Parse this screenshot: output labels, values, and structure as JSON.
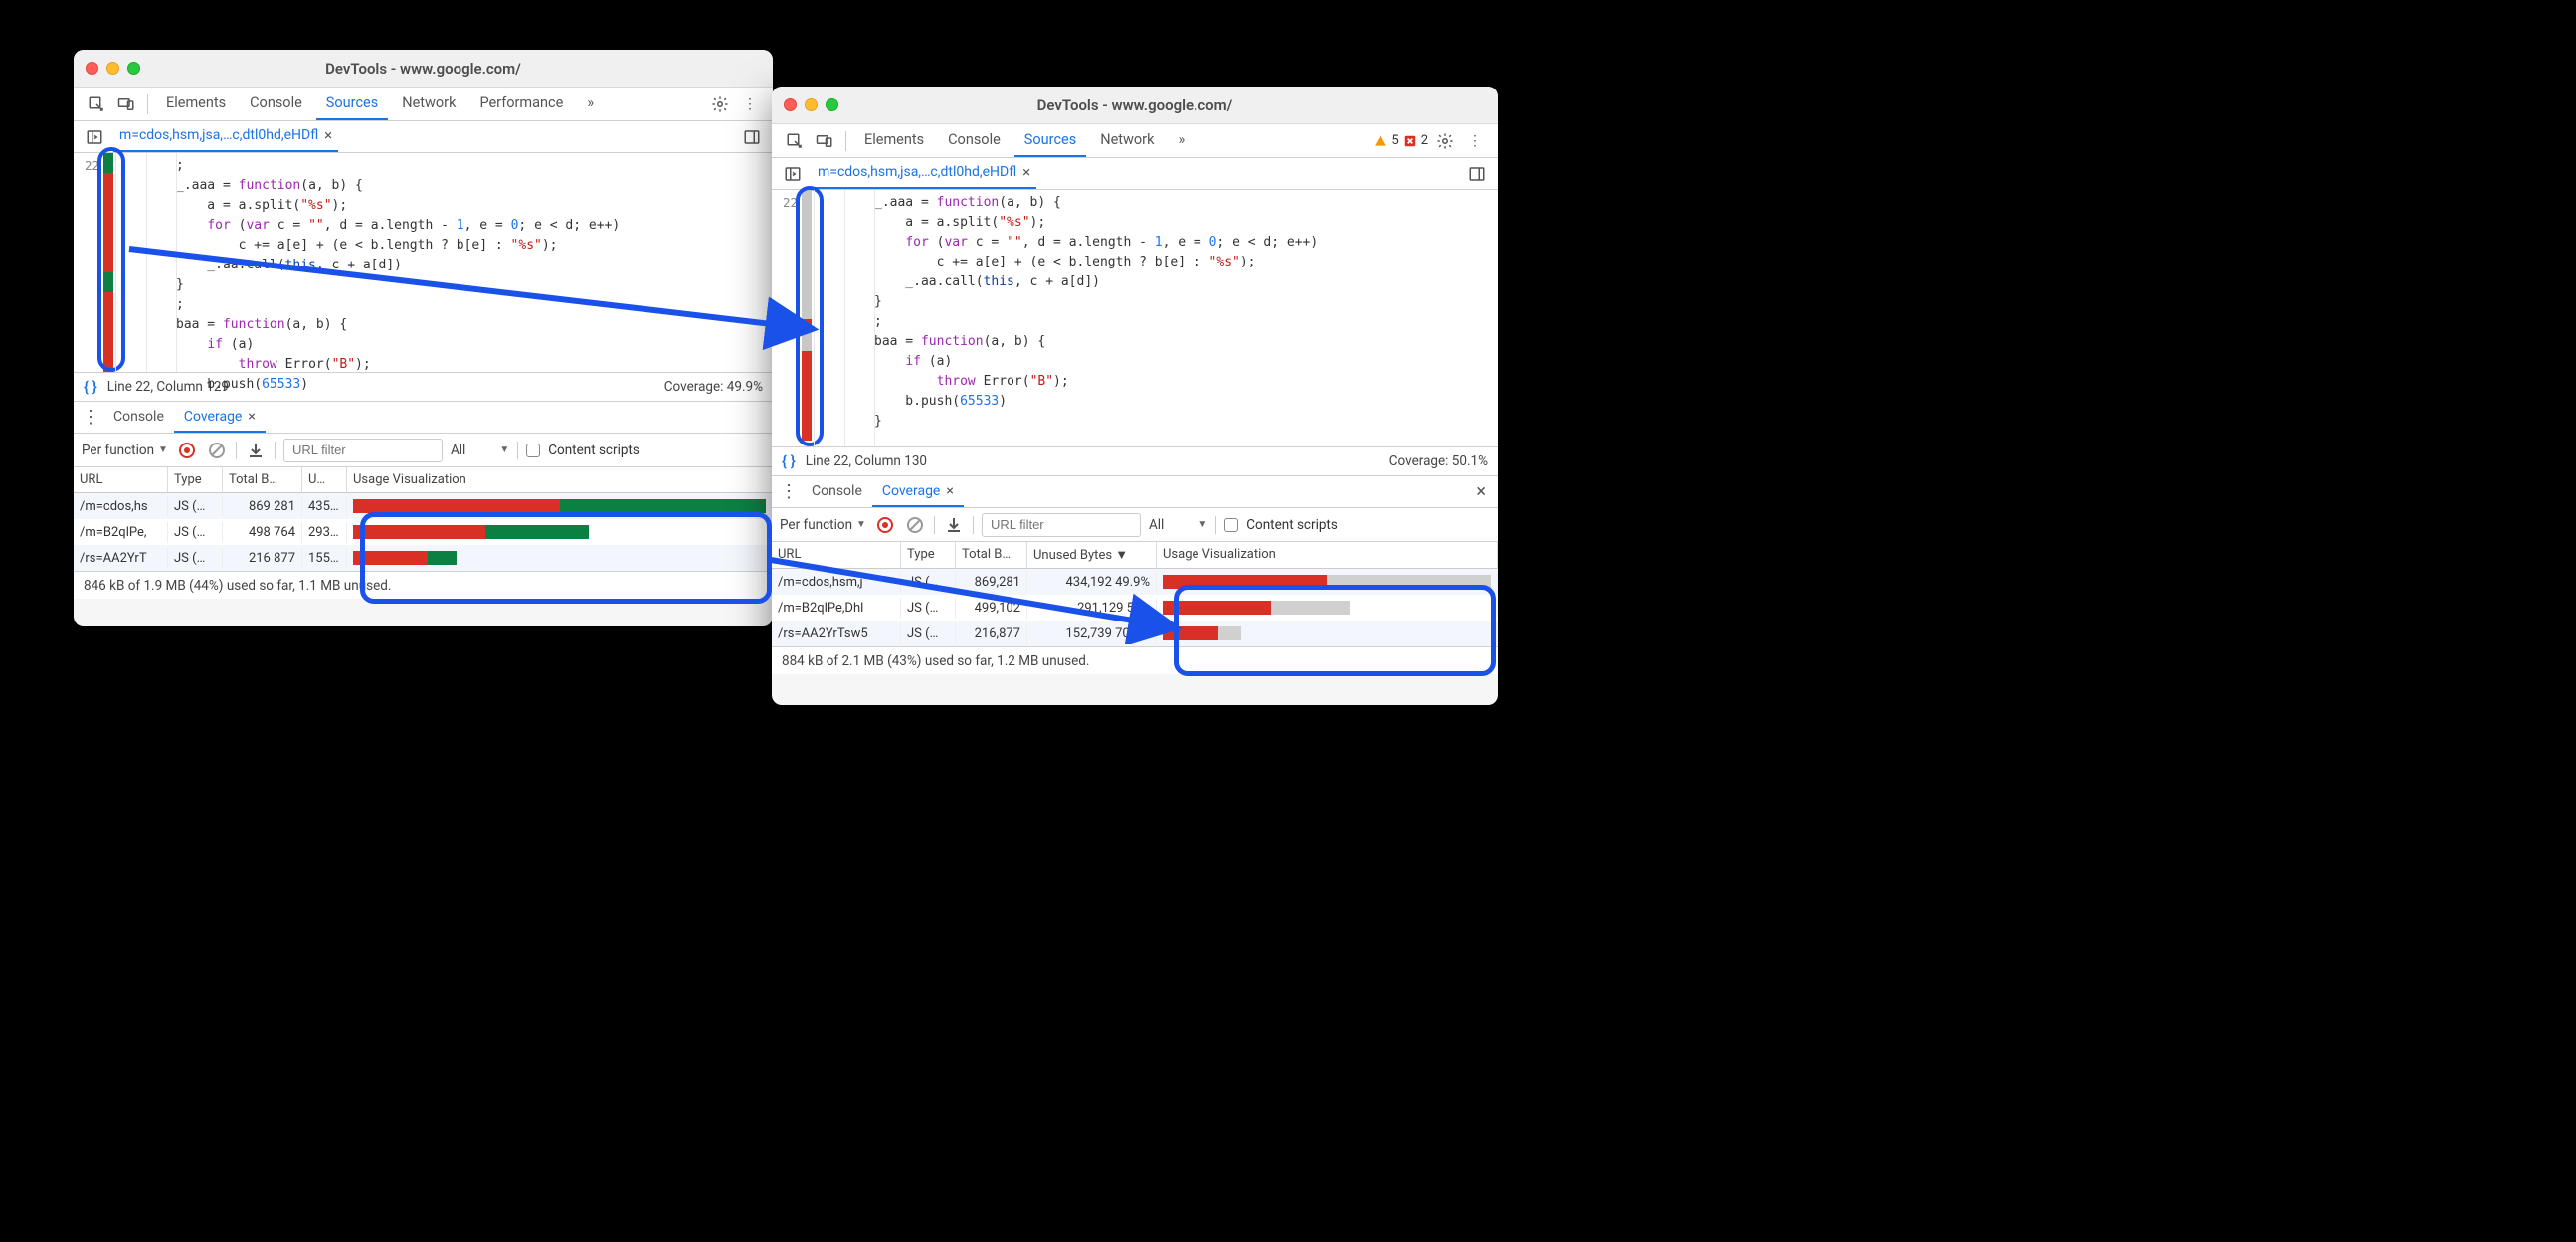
{
  "window_left": {
    "title": "DevTools - www.google.com/",
    "tabs": [
      "Elements",
      "Console",
      "Sources",
      "Network",
      "Performance"
    ],
    "active_tab": "Sources",
    "more_label": "»",
    "file_tab": "m=cdos,hsm,jsa,…c,dtl0hd,eHDfl",
    "line_number": "22",
    "code_lines": [
      "    ;",
      "    _.aaa = function(a, b) {",
      "        a = a.split(\"%s\");",
      "        for (var c = \"\", d = a.length - 1, e = 0; e < d; e++)",
      "            c += a[e] + (e < b.length ? b[e] : \"%s\");",
      "        _.aa.call(this, c + a[d])",
      "    }",
      "    ;",
      "    baa = function(a, b) {",
      "        if (a)",
      "            throw Error(\"B\");",
      "        b.push(65533)"
    ],
    "status_line": "Line 22, Column 129",
    "status_coverage": "Coverage: 49.9%",
    "drawer_tabs": [
      "Console",
      "Coverage"
    ],
    "drawer_active": "Coverage",
    "cov_mode": "Per function",
    "url_filter_placeholder": "URL filter",
    "type_filter": "All",
    "content_scripts_label": "Content scripts",
    "cov_columns": [
      "URL",
      "Type",
      "Total B…",
      "U…",
      "Usage Visualization"
    ],
    "cov_rows": [
      {
        "url": "/m=cdos,hs",
        "type": "JS (…",
        "total": "869 281",
        "unused": "435 …",
        "red": 50,
        "green": 50,
        "grey": 0,
        "scale": 100
      },
      {
        "url": "/m=B2qlPe,",
        "type": "JS (…",
        "total": "498 764",
        "unused": "293 …",
        "red": 32,
        "green": 25,
        "grey": 0,
        "scale": 57
      },
      {
        "url": "/rs=AA2YrT",
        "type": "JS (…",
        "total": "216 877",
        "unused": "155 …",
        "red": 18,
        "green": 7,
        "grey": 0,
        "scale": 25
      }
    ],
    "cov_summary": "846 kB of 1.9 MB (44%) used so far, 1.1 MB unused."
  },
  "window_right": {
    "title": "DevTools - www.google.com/",
    "tabs": [
      "Elements",
      "Console",
      "Sources",
      "Network"
    ],
    "active_tab": "Sources",
    "more_label": "»",
    "warn_count": "5",
    "error_count": "2",
    "file_tab": "m=cdos,hsm,jsa,…c,dtl0hd,eHDfl",
    "line_number": "22",
    "code_lines": [
      "_.aaa = function(a, b) {",
      "    a = a.split(\"%s\");",
      "    for (var c = \"\", d = a.length - 1, e = 0; e < d; e++)",
      "        c += a[e] + (e < b.length ? b[e] : \"%s\");",
      "    _.aa.call(this, c + a[d])",
      "}",
      ";",
      "baa = function(a, b) {",
      "    if (a)",
      "        throw Error(\"B\");",
      "    b.push(65533)",
      "}"
    ],
    "status_line": "Line 22, Column 130",
    "status_coverage": "Coverage: 50.1%",
    "drawer_tabs": [
      "Console",
      "Coverage"
    ],
    "drawer_active": "Coverage",
    "cov_mode": "Per function",
    "url_filter_placeholder": "URL filter",
    "type_filter": "All",
    "content_scripts_label": "Content scripts",
    "cov_columns": [
      "URL",
      "Type",
      "Total B…",
      "Unused Bytes ▼",
      "Usage Visualization"
    ],
    "cov_rows": [
      {
        "url": "/m=cdos,hsm,j",
        "type": "JS (…",
        "total": "869,281",
        "unused": "434,192  49.9%",
        "red": 50,
        "grey": 50,
        "scale": 100
      },
      {
        "url": "/m=B2qlPe,Dhl",
        "type": "JS (…",
        "total": "499,102",
        "unused": "291,129  58…",
        "red": 33,
        "grey": 24,
        "scale": 57
      },
      {
        "url": "/rs=AA2YrTsw5",
        "type": "JS (…",
        "total": "216,877",
        "unused": "152,739  70.4%",
        "red": 17,
        "grey": 7,
        "scale": 24
      }
    ],
    "cov_summary": "884 kB of 2.1 MB (43%) used so far, 1.2 MB unused."
  }
}
